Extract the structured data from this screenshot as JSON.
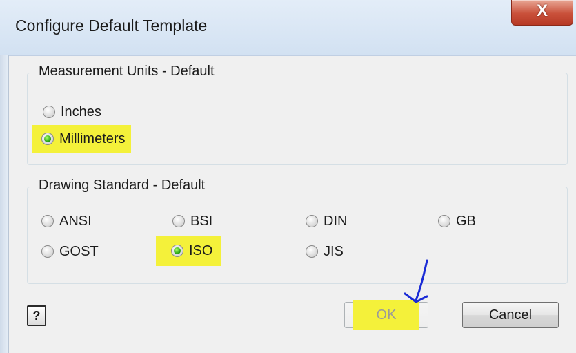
{
  "window": {
    "title": "Configure Default Template",
    "close_glyph": "X"
  },
  "measurement": {
    "legend": "Measurement Units - Default",
    "options": [
      {
        "label": "Inches",
        "selected": false
      },
      {
        "label": "Millimeters",
        "selected": true
      }
    ]
  },
  "standard": {
    "legend": "Drawing Standard - Default",
    "options": [
      {
        "label": "ANSI",
        "selected": false
      },
      {
        "label": "BSI",
        "selected": false
      },
      {
        "label": "DIN",
        "selected": false
      },
      {
        "label": "GB",
        "selected": false
      },
      {
        "label": "GOST",
        "selected": false
      },
      {
        "label": "ISO",
        "selected": true
      },
      {
        "label": "JIS",
        "selected": false
      }
    ]
  },
  "buttons": {
    "help_glyph": "?",
    "ok_label": "OK",
    "cancel_label": "Cancel"
  },
  "colors": {
    "highlight": "#f4f13a",
    "annotation_arrow": "#1a2bd6",
    "radio_selected": "#2aa614"
  },
  "icons": {
    "help": "help-question-icon",
    "close": "close-x-icon",
    "annotation": "hand-drawn-arrow-icon"
  }
}
